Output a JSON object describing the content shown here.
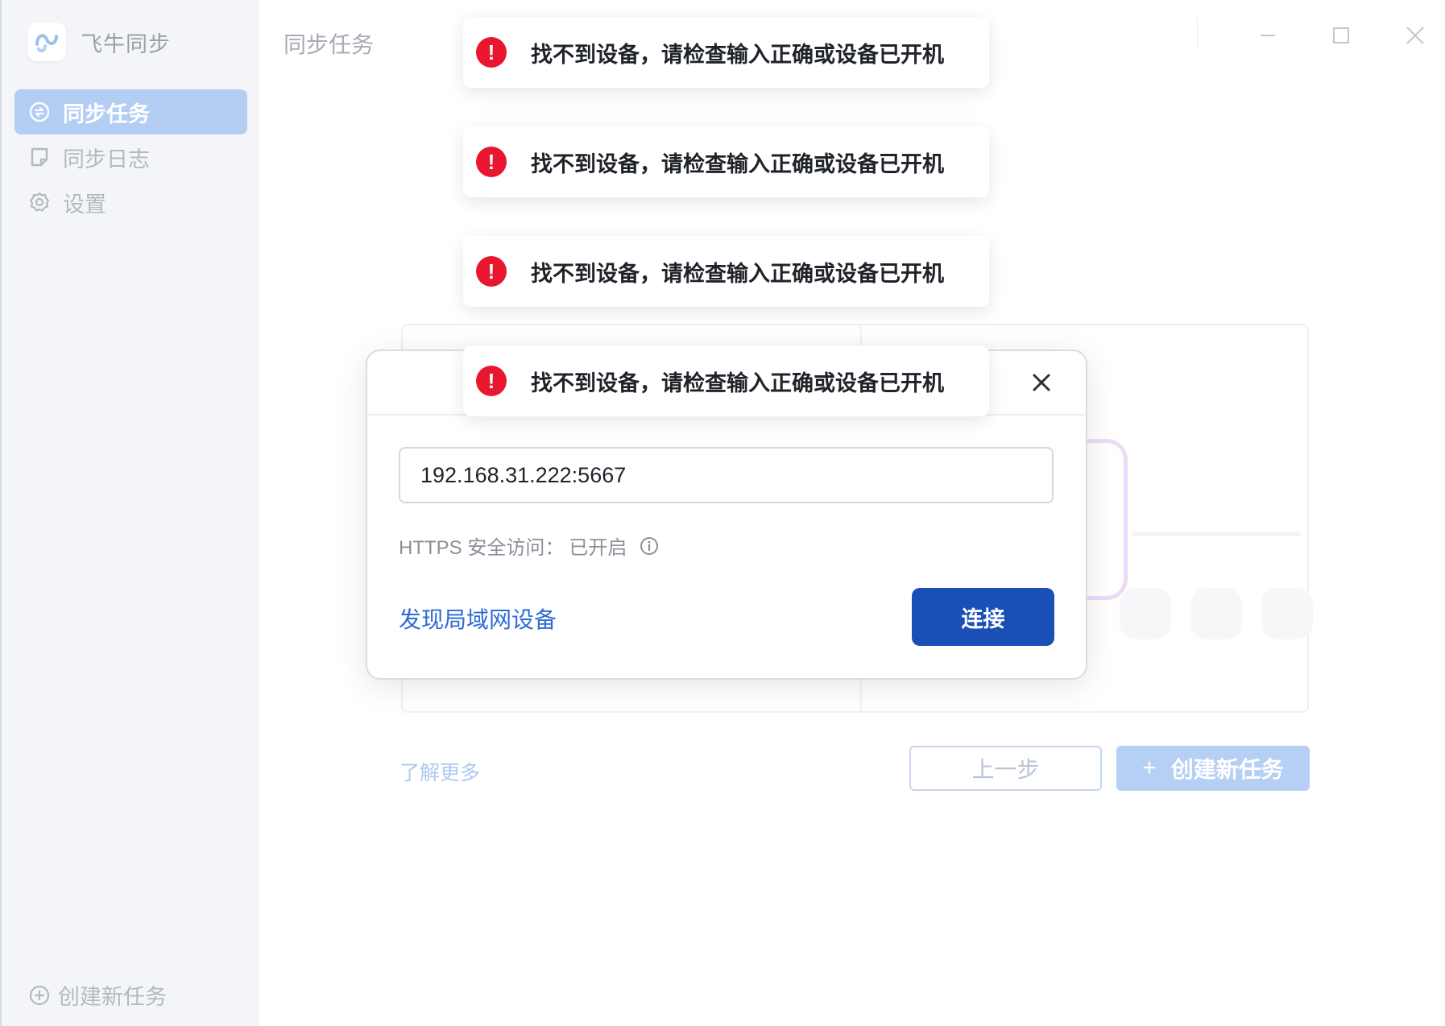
{
  "app": {
    "name": "飞牛同步"
  },
  "sidebar": {
    "items": [
      {
        "label": "同步任务",
        "icon": "sync-task-icon",
        "active": true
      },
      {
        "label": "同步日志",
        "icon": "log-icon",
        "active": false
      },
      {
        "label": "设置",
        "icon": "gear-icon",
        "active": false
      }
    ],
    "create_task": "创建新任务"
  },
  "header": {
    "title": "同步任务"
  },
  "main": {
    "learn_more": "了解更多",
    "prev_button": "上一步",
    "create_button": "创建新任务"
  },
  "dialog": {
    "address_value": "192.168.31.222:5667",
    "https_label": "HTTPS 安全访问：",
    "https_status": "已开启",
    "discover_link": "发现局域网设备",
    "connect_button": "连接"
  },
  "toasts": [
    {
      "message": "找不到设备，请检查输入正确或设备已开机"
    },
    {
      "message": "找不到设备，请检查输入正确或设备已开机"
    },
    {
      "message": "找不到设备，请检查输入正确或设备已开机"
    },
    {
      "message": "找不到设备，请检查输入正确或设备已开机"
    }
  ],
  "colors": {
    "accent": "#1a4fb6",
    "link": "#2f6bd4",
    "error": "#e8172f",
    "sidebar_bg": "#f3f5f9",
    "active_item": "#b3cdf3"
  }
}
